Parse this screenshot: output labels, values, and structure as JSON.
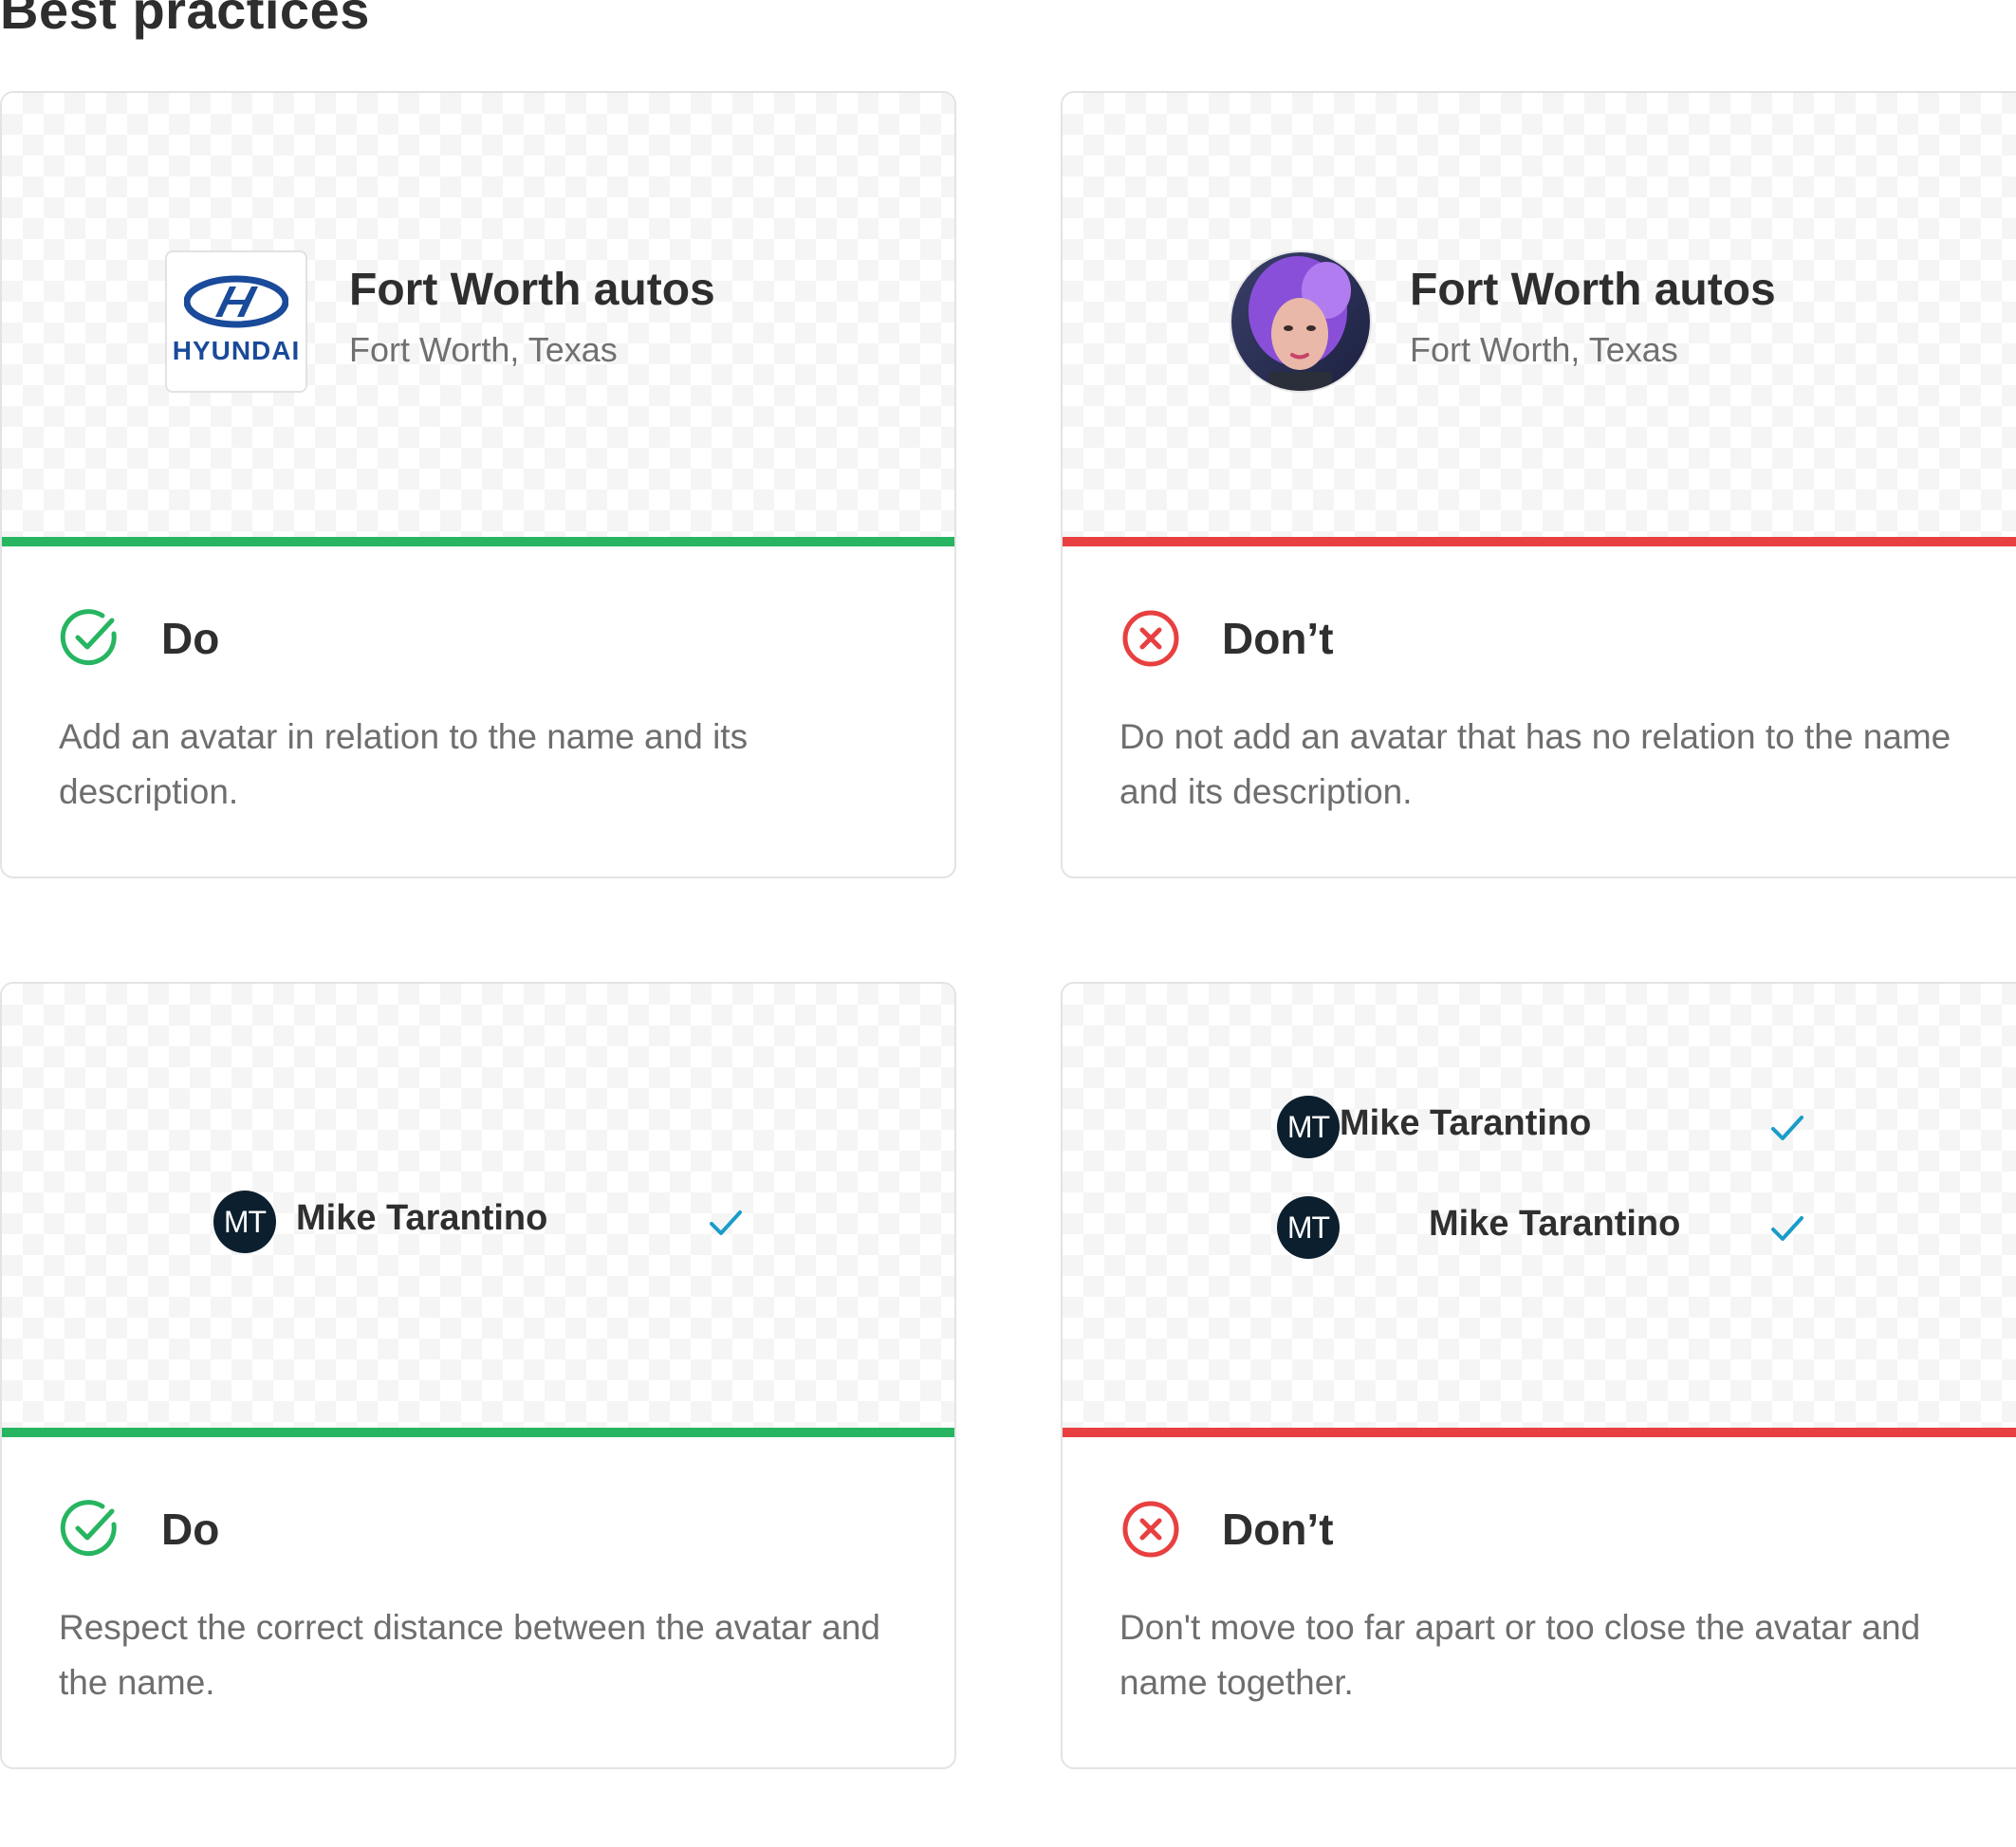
{
  "page": {
    "heading": "Best practices"
  },
  "cards": [
    {
      "variant": "do",
      "verdict": "Do",
      "description": "Add an avatar in relation to the name and its description.",
      "preview": {
        "logo_text": "HYUNDAI",
        "name": "Fort Worth autos",
        "subtitle": "Fort Worth, Texas"
      }
    },
    {
      "variant": "dont",
      "verdict": "Don’t",
      "description": "Do not add an avatar that has no relation to the name and its description.",
      "preview": {
        "name": "Fort Worth autos",
        "subtitle": "Fort Worth, Texas"
      }
    },
    {
      "variant": "do",
      "verdict": "Do",
      "description": "Respect the correct distance between the avatar and the name.",
      "preview": {
        "items": [
          {
            "initials": "MT",
            "name": "Mike Tarantino"
          }
        ]
      }
    },
    {
      "variant": "dont",
      "verdict": "Don’t",
      "description": "Don't move too far apart or too close the avatar and name together.",
      "preview": {
        "items": [
          {
            "initials": "MT",
            "name": "Mike Tarantino"
          },
          {
            "initials": "MT",
            "name": "Mike Tarantino"
          }
        ]
      }
    }
  ],
  "colors": {
    "do": "#27b561",
    "dont": "#e84040",
    "check": "#1a9cc9",
    "avatar_bg": "#0c1f2e"
  }
}
